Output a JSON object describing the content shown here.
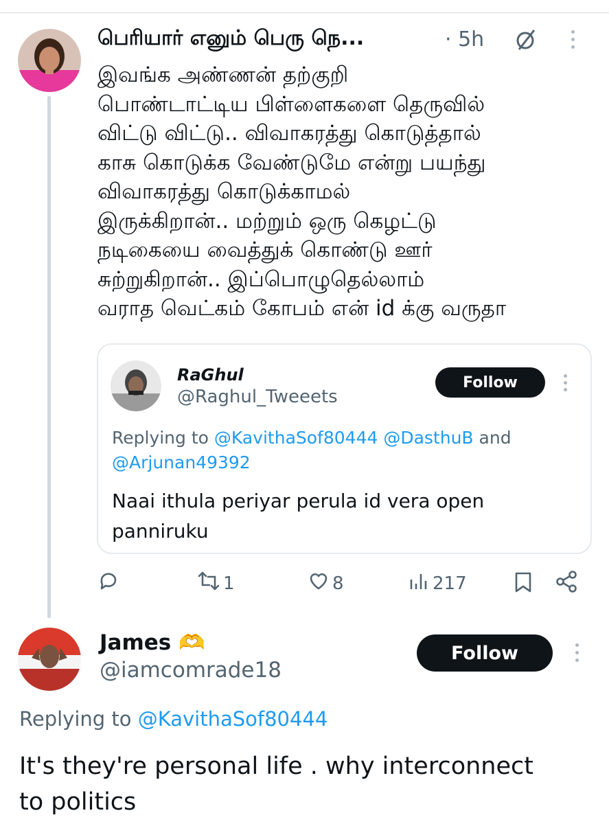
{
  "tweet": {
    "author_name": "பெரியார் எனும் பெரு நெ...",
    "time": "· 5h",
    "text": "இவங்க அண்ணன் தற்குறி\nபொண்டாட்டிய பிள்ளைகளை  தெருவில்\nவிட்டு விட்டு.. விவாகரத்து கொடுத்தால்\nகாசு கொடுக்க வேண்டுமே என்று பயந்து\nவிவாகரத்து கொடுக்காமல்\nஇருக்கிறான்.. மற்றும் ஒரு கெழட்டு\nநடிகையை வைத்துக் கொண்டு ஊர்\nசுற்றுகிறான்.. இப்பொழுதெல்லாம்\nவராத வெட்கம் கோபம் என் id க்கு வருதா",
    "quote": {
      "name": "RaGhul",
      "handle": "@Raghul_Tweeets",
      "follow_label": "Follow",
      "replying_prefix": "Replying to",
      "replying_users_line1": "@KavithaSof80444 @DasthuB",
      "replying_and": "and",
      "replying_users_line2": "@Arjunan49392",
      "text": "Naai ithula periyar perula id vera open\npanniruku"
    },
    "actions": {
      "retweets": "1",
      "likes": "8",
      "views": "217"
    }
  },
  "reply": {
    "name": "James",
    "badge_emoji": "🫶",
    "handle": "@iamcomrade18",
    "follow_label": "Follow",
    "replying_prefix": "Replying to",
    "replying_user": "@KavithaSof80444",
    "text": "It's they're personal life . why interconnect\nto politics"
  },
  "colors": {
    "link": "#1d9bf0",
    "muted": "#536471",
    "button": "#0f1419",
    "thread_line": "#cfd9de"
  }
}
